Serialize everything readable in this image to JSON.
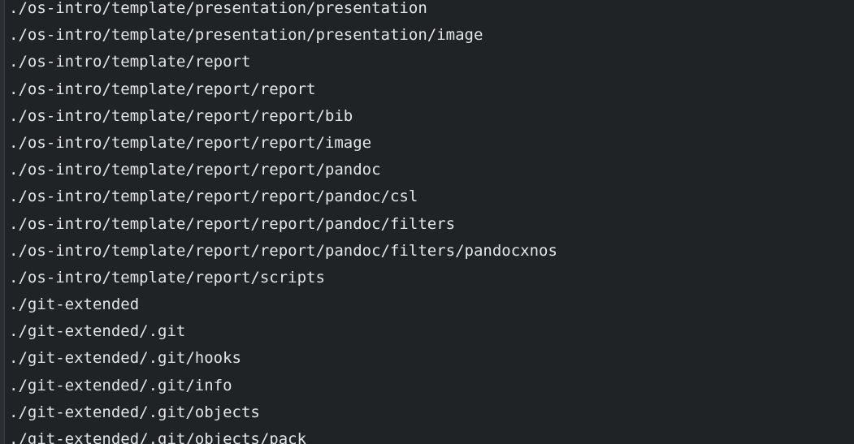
{
  "terminal": {
    "lines": [
      "./os-intro/template/presentation/presentation",
      "./os-intro/template/presentation/presentation/image",
      "./os-intro/template/report",
      "./os-intro/template/report/report",
      "./os-intro/template/report/report/bib",
      "./os-intro/template/report/report/image",
      "./os-intro/template/report/report/pandoc",
      "./os-intro/template/report/report/pandoc/csl",
      "./os-intro/template/report/report/pandoc/filters",
      "./os-intro/template/report/report/pandoc/filters/pandocxnos",
      "./os-intro/template/report/scripts",
      "./git-extended",
      "./git-extended/.git",
      "./git-extended/.git/hooks",
      "./git-extended/.git/info",
      "./git-extended/.git/objects",
      "./git-extended/.git/objects/pack"
    ]
  },
  "colors": {
    "background": "#202326",
    "text": "#e3e6e8"
  }
}
